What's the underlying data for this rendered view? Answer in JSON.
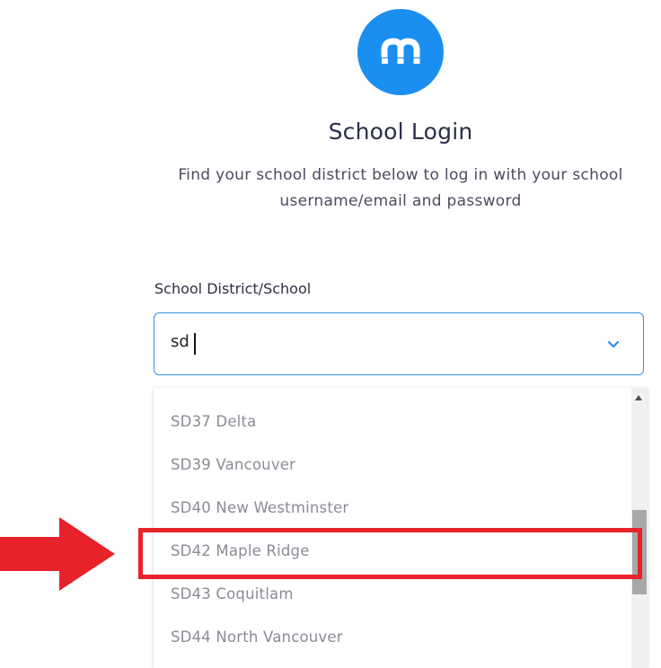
{
  "logo": {
    "icon": "logo-m-icon",
    "color": "#1a8ff0"
  },
  "header": {
    "title": "School Login",
    "subtitle": "Find your school district below to log in with your school username/email and password"
  },
  "field": {
    "label": "School District/School",
    "value": "sd",
    "icon": "chevron-down-icon",
    "focus_color": "#3b8fe0"
  },
  "dropdown": {
    "options": [
      "SD37 Delta",
      "SD39 Vancouver",
      "SD40 New Westminster",
      "SD42 Maple Ridge",
      "SD43 Coquitlam",
      "SD44 North Vancouver"
    ],
    "highlighted_option": "SD42 Maple Ridge"
  },
  "annotation": {
    "arrow_icon": "red-arrow-icon",
    "color": "#e8222a"
  }
}
